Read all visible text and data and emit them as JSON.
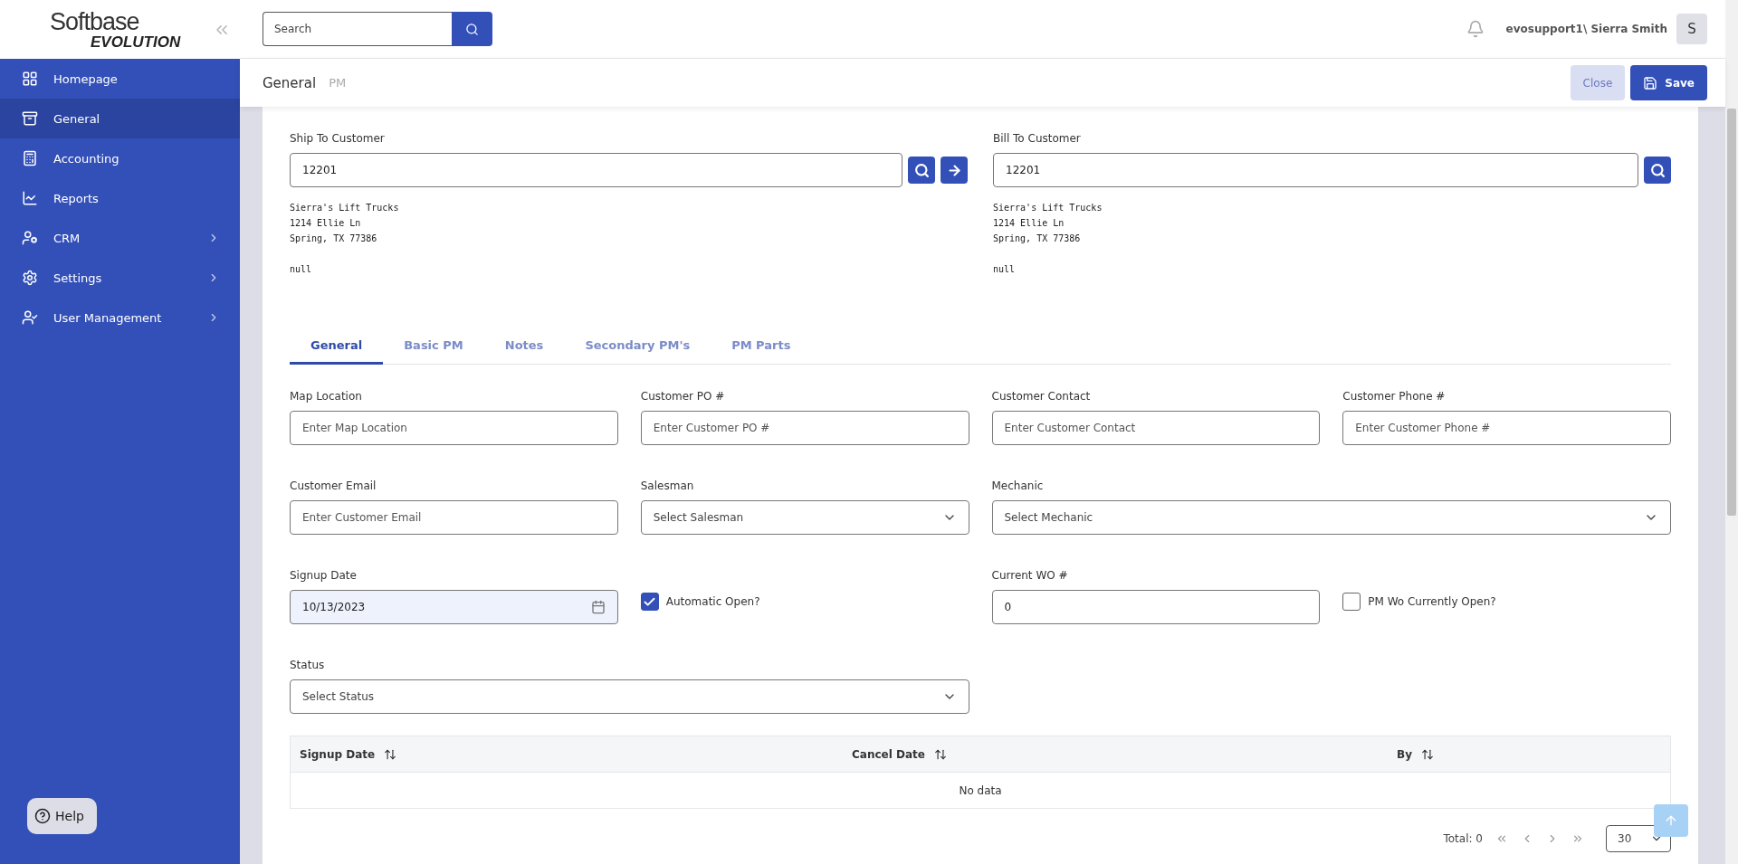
{
  "logo": {
    "line_1": "Softbase",
    "line_2": "EVOLUTION"
  },
  "sidebar": {
    "items": [
      {
        "label": "Homepage",
        "selected": false,
        "has_submenu": false
      },
      {
        "label": "General",
        "selected": true,
        "has_submenu": false
      },
      {
        "label": "Accounting",
        "selected": false,
        "has_submenu": false
      },
      {
        "label": "Reports",
        "selected": false,
        "has_submenu": false
      },
      {
        "label": "CRM",
        "selected": false,
        "has_submenu": true
      },
      {
        "label": "Settings",
        "selected": false,
        "has_submenu": true
      },
      {
        "label": "User Management",
        "selected": false,
        "has_submenu": true
      }
    ],
    "help_button": "Help"
  },
  "header": {
    "search": {
      "placeholder": "Search"
    },
    "user": "evosupport1\\ Sierra Smith",
    "avatar": "S"
  },
  "breadcrumb": [
    "General",
    "PM"
  ],
  "actions": {
    "close": "Close",
    "save": "Save"
  },
  "ship_to": {
    "label": "Ship To Customer",
    "value": "12201",
    "address": [
      "Sierra's Lift Trucks",
      "1214 Ellie Ln",
      "Spring, TX 77386"
    ],
    "note": "null"
  },
  "bill_to": {
    "label": "Bill To Customer",
    "value": "12201",
    "address": [
      "Sierra's Lift Trucks",
      "1214 Ellie Ln",
      "Spring, TX 77386"
    ],
    "note": "null"
  },
  "tabs": [
    {
      "label": "General",
      "selected": true
    },
    {
      "label": "Basic PM",
      "selected": false
    },
    {
      "label": "Notes",
      "selected": false
    },
    {
      "label": "Secondary PM's",
      "selected": false
    },
    {
      "label": "PM Parts",
      "selected": false
    }
  ],
  "fields": [
    {
      "kind": "text",
      "label": "Map Location",
      "placeholder": "Enter Map Location"
    },
    {
      "kind": "text",
      "label": "Customer PO #",
      "placeholder": "Enter Customer PO #"
    },
    {
      "kind": "text",
      "label": "Customer Contact",
      "placeholder": "Enter Customer Contact"
    },
    {
      "kind": "text",
      "label": "Customer Phone #",
      "placeholder": "Enter Customer Phone #"
    },
    {
      "kind": "text",
      "label": "Customer Email",
      "placeholder": "Enter Customer Email"
    },
    {
      "kind": "select",
      "label": "Salesman",
      "placeholder": "Select Salesman"
    },
    {
      "kind": "select",
      "label": "Mechanic",
      "placeholder": "Select Mechanic"
    },
    {
      "kind": "date",
      "label": "Signup Date",
      "value": "10/13/2023"
    },
    {
      "kind": "checkbox",
      "label": "Automatic Open?",
      "checked": true
    },
    {
      "kind": "text",
      "label": "Current WO #",
      "value": "0"
    },
    {
      "kind": "checkbox",
      "label": "PM Wo Currently Open?",
      "checked": false
    },
    {
      "kind": "select",
      "label": "Status",
      "placeholder": "Select Status"
    }
  ],
  "table": {
    "columns": [
      "Signup Date",
      "Cancel Date",
      "By"
    ],
    "empty_text": "No data"
  },
  "pagination": {
    "total": "Total: 0",
    "page_size": "30"
  }
}
